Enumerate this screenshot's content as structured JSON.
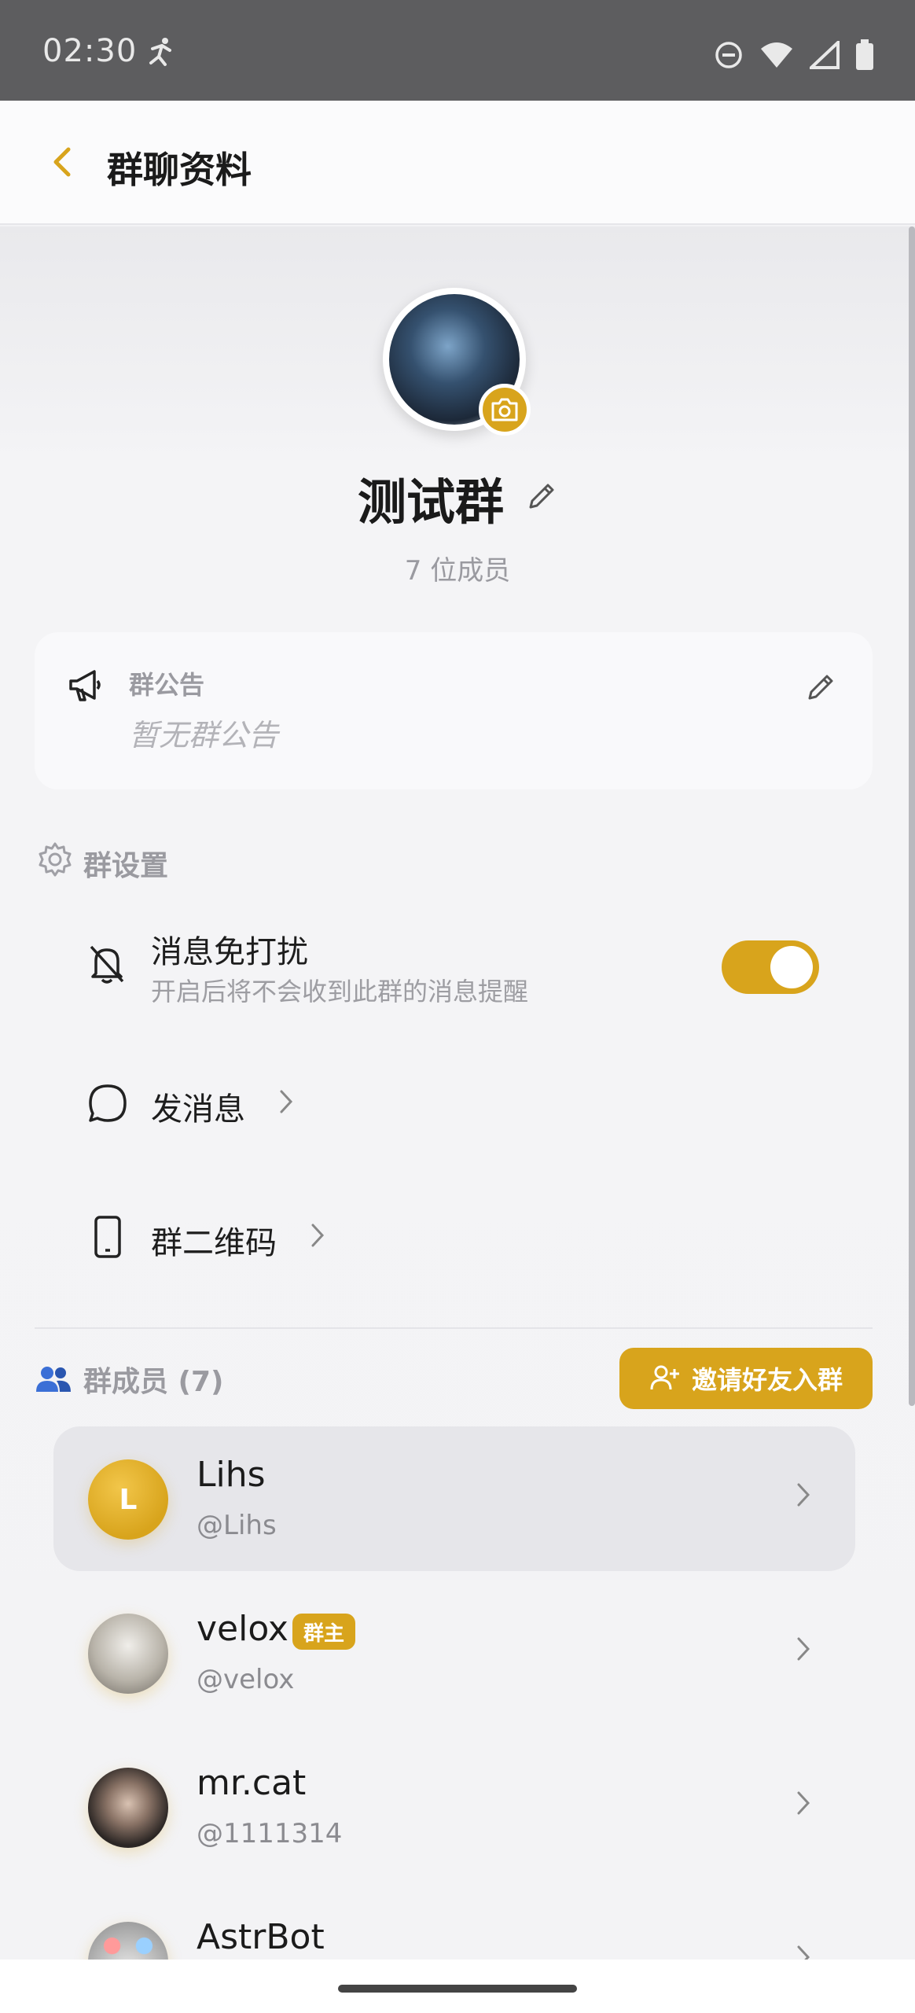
{
  "status_bar": {
    "time": "02:30"
  },
  "app_bar": {
    "title": "群聊资料"
  },
  "group": {
    "name": "测试群",
    "member_count": "7 位成员"
  },
  "notice": {
    "label": "群公告",
    "text": "暂无群公告"
  },
  "settings": {
    "label": "群设置",
    "mute": {
      "title": "消息免打扰",
      "subtitle": "开启后将不会收到此群的消息提醒",
      "enabled": true
    },
    "send_message": {
      "title": "发消息"
    },
    "qr_code": {
      "title": "群二维码"
    }
  },
  "members": {
    "label": "群成员 (7)",
    "invite_label": "邀请好友入群",
    "list": [
      {
        "name": "Lihs",
        "handle": "@Lihs",
        "initial": "L"
      },
      {
        "name": "velox",
        "handle": "@velox",
        "badge": "群主"
      },
      {
        "name": "mr.cat",
        "handle": "@1111314"
      },
      {
        "name": "AstrBot",
        "handle": ""
      }
    ]
  },
  "colors": {
    "accent": "#d8a41c",
    "status_bar": "#5d5d5f"
  }
}
